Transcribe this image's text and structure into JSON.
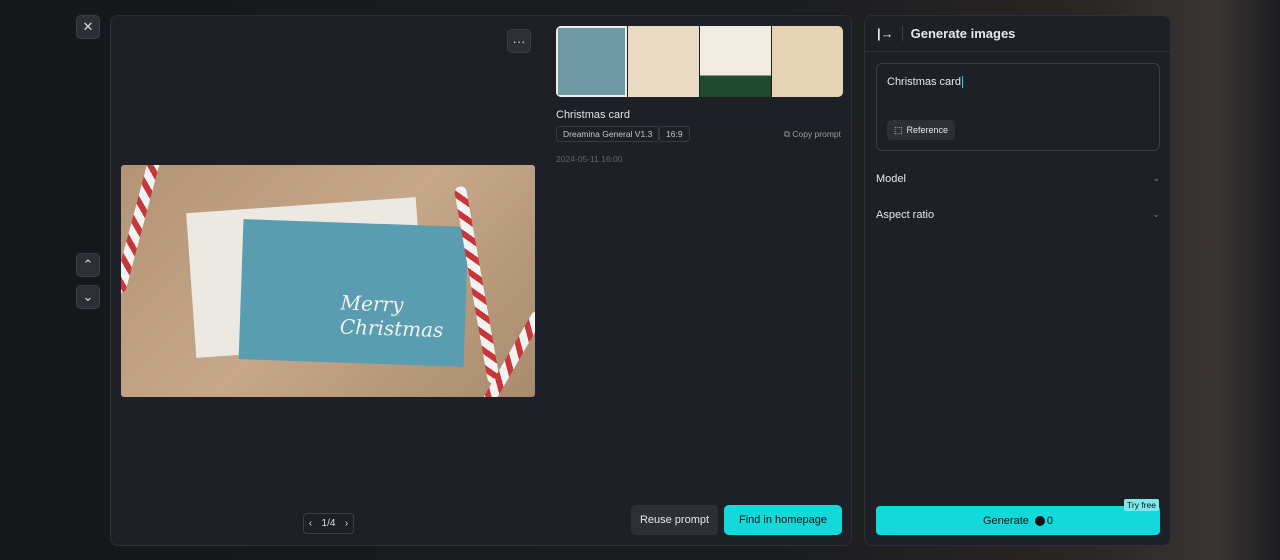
{
  "nav": {
    "close": "✕",
    "up": "⌃",
    "down": "⌄",
    "more": "···"
  },
  "viewer": {
    "title": "Christmas card",
    "model_tag": "Dreamina General V1.3",
    "ratio_tag": "16:9",
    "copy_prompt": "Copy prompt",
    "date": "2024-05-11 16:00",
    "card_text": "Merry Christmas",
    "pager": "1/4",
    "reuse": "Reuse prompt",
    "find": "Find in homepage"
  },
  "panel": {
    "title": "Generate images",
    "prompt_value": "Christmas card",
    "reference": "Reference",
    "model": "Model",
    "aspect": "Aspect ratio",
    "generate": "Generate",
    "credits": "0",
    "try_free": "Try free"
  },
  "colors": {
    "accent": "#12d9da"
  }
}
